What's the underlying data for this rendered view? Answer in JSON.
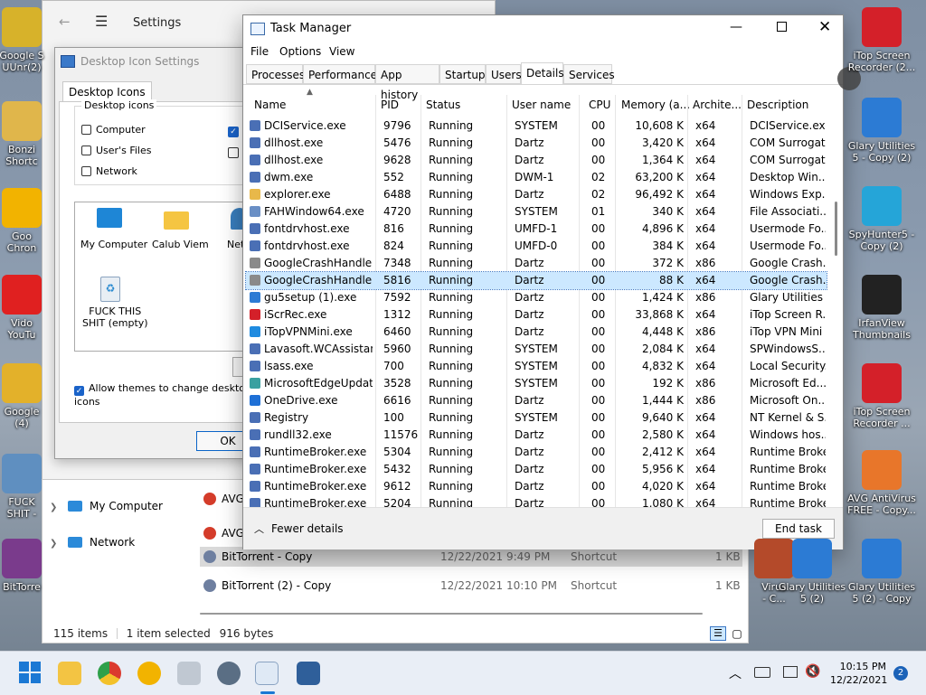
{
  "desktop": {
    "left_icons": [
      {
        "label": "Google S\nUUnr(2)",
        "color": "#d7b22a"
      },
      {
        "label": "Bonzi\nShortc",
        "color": "#e0b64b"
      },
      {
        "label": "Goo\nChron",
        "color": "#f2b300"
      },
      {
        "label": "Vido\nYouTu",
        "color": "#e02020"
      },
      {
        "label": "Google\n(4)",
        "color": "#e3b12a"
      },
      {
        "label": "FUCK\nSHIT -",
        "color": "#5f8fc0"
      },
      {
        "label": "BitTorre",
        "color": "#7a3b8c"
      }
    ],
    "right_icons": [
      {
        "label": "iTop Screen\nRecorder (2...",
        "color": "#d42029"
      },
      {
        "label": "Glary Utilities\n5 - Copy (2)",
        "color": "#2c7bd4"
      },
      {
        "label": "SpyHunter5 -\nCopy (2)",
        "color": "#25a5d8"
      },
      {
        "label": "IrfanView\nThumbnails",
        "color": "#222222"
      },
      {
        "label": "iTop Screen\nRecorder ...",
        "color": "#d42029"
      },
      {
        "label": "AVG AntiVirus\nFREE - Copy...",
        "color": "#e8762a"
      },
      {
        "label": "Glary Utilities\n5 (2) - Copy",
        "color": "#2c7bd4"
      }
    ],
    "mid_icons": [
      {
        "label": "Virus\n- C...",
        "color": "#b44a2a"
      },
      {
        "label": "Glary Utilities\n5 (2)",
        "color": "#2c7bd4"
      }
    ]
  },
  "settings": {
    "title": "Settings"
  },
  "dialog": {
    "title": "Desktop Icon Settings",
    "tab": "Desktop Icons",
    "group": "Desktop icons",
    "checks": [
      {
        "label": "Computer",
        "checked": false
      },
      {
        "label": "User's Files",
        "checked": false
      },
      {
        "label": "Network",
        "checked": false
      }
    ],
    "icons": [
      {
        "label": "My Computer"
      },
      {
        "label": "Calub Viem"
      },
      {
        "label": "Netw"
      },
      {
        "label": "FUCK THIS\nSHIT (empty)"
      }
    ],
    "allow_themes": "Allow themes to change desktop icons",
    "ok": "OK"
  },
  "explorer": {
    "nav": [
      {
        "label": "My Computer"
      },
      {
        "label": "Network"
      }
    ],
    "files": [
      {
        "name": "AVG",
        "date": "",
        "type": "",
        "size": ""
      },
      {
        "name": "AVG",
        "date": "",
        "type": "",
        "size": ""
      },
      {
        "name": "BitTorrent - Copy",
        "date": "12/22/2021 9:49 PM",
        "type": "Shortcut",
        "size": "1 KB"
      },
      {
        "name": "BitTorrent (2) - Copy",
        "date": "12/22/2021 10:10 PM",
        "type": "Shortcut",
        "size": "1 KB"
      }
    ],
    "status_items": "115 items",
    "status_selected": "1 item selected",
    "status_size": "916 bytes"
  },
  "taskmanager": {
    "title": "Task Manager",
    "menu": [
      "File",
      "Options",
      "View"
    ],
    "tabs": [
      "Processes",
      "Performance",
      "App history",
      "Startup",
      "Users",
      "Details",
      "Services"
    ],
    "active_tab": "Details",
    "columns": [
      "Name",
      "PID",
      "Status",
      "User name",
      "CPU",
      "Memory (a...",
      "Archite...",
      "Description"
    ],
    "rows": [
      {
        "name": "DCIService.exe",
        "pid": "9796",
        "status": "Running",
        "user": "SYSTEM",
        "cpu": "00",
        "mem": "10,608 K",
        "arch": "x64",
        "desc": "DCIService.exe",
        "icon": "#4a6fb5"
      },
      {
        "name": "dllhost.exe",
        "pid": "5476",
        "status": "Running",
        "user": "Dartz",
        "cpu": "00",
        "mem": "3,420 K",
        "arch": "x64",
        "desc": "COM Surrogate",
        "icon": "#4a6fb5"
      },
      {
        "name": "dllhost.exe",
        "pid": "9628",
        "status": "Running",
        "user": "Dartz",
        "cpu": "00",
        "mem": "1,364 K",
        "arch": "x64",
        "desc": "COM Surrogate",
        "icon": "#4a6fb5"
      },
      {
        "name": "dwm.exe",
        "pid": "552",
        "status": "Running",
        "user": "DWM-1",
        "cpu": "02",
        "mem": "63,200 K",
        "arch": "x64",
        "desc": "Desktop Win...",
        "icon": "#4a6fb5"
      },
      {
        "name": "explorer.exe",
        "pid": "6488",
        "status": "Running",
        "user": "Dartz",
        "cpu": "02",
        "mem": "96,492 K",
        "arch": "x64",
        "desc": "Windows Exp...",
        "icon": "#e8b84a"
      },
      {
        "name": "FAHWindow64.exe",
        "pid": "4720",
        "status": "Running",
        "user": "SYSTEM",
        "cpu": "01",
        "mem": "340 K",
        "arch": "x64",
        "desc": "File Associati...",
        "icon": "#6a8fc5"
      },
      {
        "name": "fontdrvhost.exe",
        "pid": "816",
        "status": "Running",
        "user": "UMFD-1",
        "cpu": "00",
        "mem": "4,896 K",
        "arch": "x64",
        "desc": "Usermode Fo...",
        "icon": "#4a6fb5"
      },
      {
        "name": "fontdrvhost.exe",
        "pid": "824",
        "status": "Running",
        "user": "UMFD-0",
        "cpu": "00",
        "mem": "384 K",
        "arch": "x64",
        "desc": "Usermode Fo...",
        "icon": "#4a6fb5"
      },
      {
        "name": "GoogleCrashHandler...",
        "pid": "7348",
        "status": "Running",
        "user": "Dartz",
        "cpu": "00",
        "mem": "372 K",
        "arch": "x86",
        "desc": "Google Crash...",
        "icon": "#8a8a8a"
      },
      {
        "name": "GoogleCrashHandler...",
        "pid": "5816",
        "status": "Running",
        "user": "Dartz",
        "cpu": "00",
        "mem": "88 K",
        "arch": "x64",
        "desc": "Google Crash...",
        "icon": "#8a8a8a",
        "selected": true
      },
      {
        "name": "gu5setup (1).exe",
        "pid": "7592",
        "status": "Running",
        "user": "Dartz",
        "cpu": "00",
        "mem": "1,424 K",
        "arch": "x86",
        "desc": "Glary Utilities ...",
        "icon": "#2c7bd4"
      },
      {
        "name": "iScrRec.exe",
        "pid": "1312",
        "status": "Running",
        "user": "Dartz",
        "cpu": "00",
        "mem": "33,868 K",
        "arch": "x64",
        "desc": "iTop Screen R...",
        "icon": "#d42029"
      },
      {
        "name": "iTopVPNMini.exe",
        "pid": "6460",
        "status": "Running",
        "user": "Dartz",
        "cpu": "00",
        "mem": "4,448 K",
        "arch": "x86",
        "desc": "iTop VPN Mini",
        "icon": "#1f8be0"
      },
      {
        "name": "Lavasoft.WCAssistan...",
        "pid": "5960",
        "status": "Running",
        "user": "SYSTEM",
        "cpu": "00",
        "mem": "2,084 K",
        "arch": "x64",
        "desc": "SPWindowsS...",
        "icon": "#4a6fb5"
      },
      {
        "name": "lsass.exe",
        "pid": "700",
        "status": "Running",
        "user": "SYSTEM",
        "cpu": "00",
        "mem": "4,832 K",
        "arch": "x64",
        "desc": "Local Security...",
        "icon": "#4a6fb5"
      },
      {
        "name": "MicrosoftEdgeUpdat...",
        "pid": "3528",
        "status": "Running",
        "user": "SYSTEM",
        "cpu": "00",
        "mem": "192 K",
        "arch": "x86",
        "desc": "Microsoft Ed...",
        "icon": "#3aa0a0"
      },
      {
        "name": "OneDrive.exe",
        "pid": "6616",
        "status": "Running",
        "user": "Dartz",
        "cpu": "00",
        "mem": "1,444 K",
        "arch": "x86",
        "desc": "Microsoft On...",
        "icon": "#1f70d6"
      },
      {
        "name": "Registry",
        "pid": "100",
        "status": "Running",
        "user": "SYSTEM",
        "cpu": "00",
        "mem": "9,640 K",
        "arch": "x64",
        "desc": "NT Kernel & S...",
        "icon": "#4a6fb5"
      },
      {
        "name": "rundll32.exe",
        "pid": "11576",
        "status": "Running",
        "user": "Dartz",
        "cpu": "00",
        "mem": "2,580 K",
        "arch": "x64",
        "desc": "Windows hos...",
        "icon": "#4a6fb5"
      },
      {
        "name": "RuntimeBroker.exe",
        "pid": "5304",
        "status": "Running",
        "user": "Dartz",
        "cpu": "00",
        "mem": "2,412 K",
        "arch": "x64",
        "desc": "Runtime Broker",
        "icon": "#4a6fb5"
      },
      {
        "name": "RuntimeBroker.exe",
        "pid": "5432",
        "status": "Running",
        "user": "Dartz",
        "cpu": "00",
        "mem": "5,956 K",
        "arch": "x64",
        "desc": "Runtime Broker",
        "icon": "#4a6fb5"
      },
      {
        "name": "RuntimeBroker.exe",
        "pid": "9612",
        "status": "Running",
        "user": "Dartz",
        "cpu": "00",
        "mem": "4,020 K",
        "arch": "x64",
        "desc": "Runtime Broker",
        "icon": "#4a6fb5"
      },
      {
        "name": "RuntimeBroker.exe",
        "pid": "5204",
        "status": "Running",
        "user": "Dartz",
        "cpu": "00",
        "mem": "1,080 K",
        "arch": "x64",
        "desc": "Runtime Broker",
        "icon": "#4a6fb5"
      }
    ],
    "fewer_details": "Fewer details",
    "end_task": "End task"
  },
  "taskbar": {
    "time": "10:15 PM",
    "date": "12/22/2021",
    "notification_count": "2"
  }
}
